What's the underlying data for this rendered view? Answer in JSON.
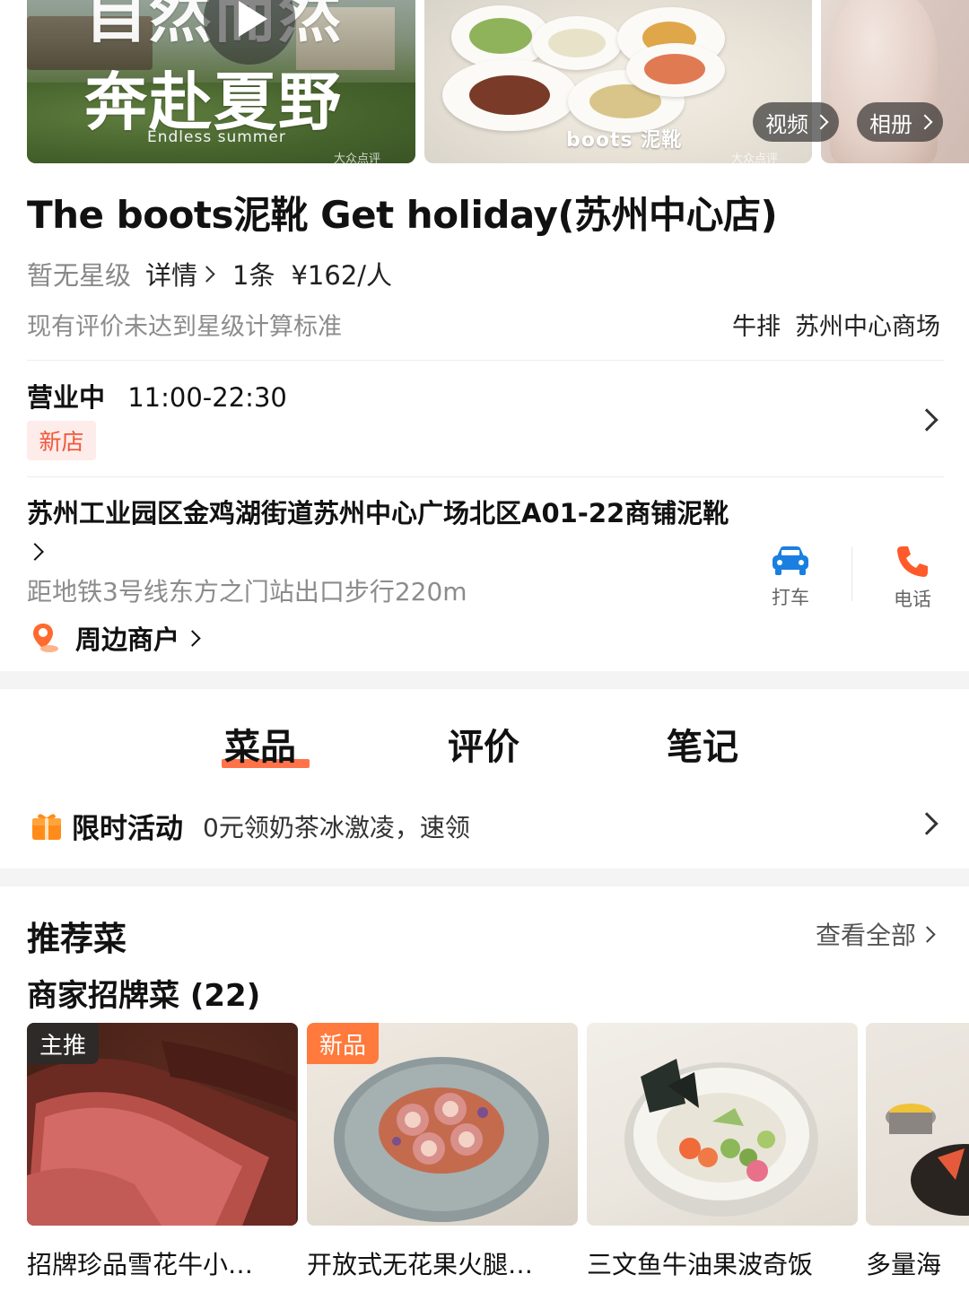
{
  "gallery": {
    "photo1_text_line1": "自然而然",
    "photo1_text_line2": "奔赴夏野",
    "photo1_caption": "Endless summer",
    "watermark": "大众点评",
    "photo2_logo": "boots 泥靴",
    "video_label": "视频",
    "album_label": "相册"
  },
  "shop": {
    "title": "The boots泥靴 Get holiday(苏州中心店)",
    "star_text": "暂无星级",
    "detail_label": "详情",
    "review_count": "1条",
    "price": "¥162/人",
    "rating_note": "现有评价未达到星级计算标准",
    "tags": [
      "牛排",
      "苏州中心商场"
    ]
  },
  "hours": {
    "status": "营业中",
    "time": "11:00-22:30",
    "badge": "新店"
  },
  "address": {
    "text": "苏州工业园区金鸡湖街道苏州中心广场北区A01-22商铺泥靴",
    "metro": "距地铁3号线东方之门站出口步行220m",
    "nearby_label": "周边商户",
    "taxi_label": "打车",
    "phone_label": "电话"
  },
  "tabs": [
    {
      "label": "菜品"
    },
    {
      "label": "评价"
    },
    {
      "label": "笔记"
    }
  ],
  "promo": {
    "title": "限时活动",
    "text": "0元领奶茶冰激凌，速领"
  },
  "recommend": {
    "title": "推荐菜",
    "see_all": "查看全部",
    "subtitle": "商家招牌菜 (22)",
    "dishes": [
      {
        "name": "招牌珍品雪花牛小…",
        "badge": "主推"
      },
      {
        "name": "开放式无花果火腿…",
        "badge": "新品"
      },
      {
        "name": "三文鱼牛油果波奇饭",
        "badge": ""
      },
      {
        "name": "多量海",
        "badge": ""
      }
    ]
  },
  "colors": {
    "accent": "#ff5a2a",
    "badge_bg": "#fdecea",
    "badge_text": "#f2563a",
    "taxi_icon": "#1a7fe0",
    "phone_icon": "#ff5a2a",
    "gift_icon": "#ff8c1a"
  }
}
